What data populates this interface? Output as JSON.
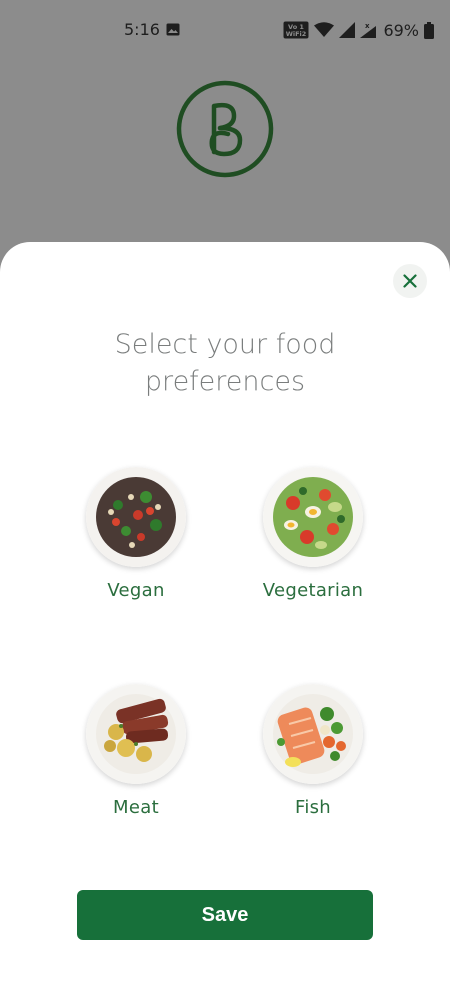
{
  "status_bar": {
    "time": "5:16",
    "image_icon": "image-icon",
    "volte_text": "Vo⁽¹ WiFi²",
    "wifi_icon": "wifi-icon",
    "signal_icon": "signal-icon",
    "signal_x_icon": "signal-no-service-icon",
    "battery_percent": "69%",
    "battery_icon": "battery-icon"
  },
  "background": {
    "logo_icon": "brand-logo-icon",
    "logo_color": "#1f4d22"
  },
  "sheet": {
    "close_icon": "close-icon",
    "title_line1": "Select your food",
    "title_line2": "preferences",
    "options": [
      {
        "label": "Vegan",
        "image": "vegan-dish-image"
      },
      {
        "label": "Vegetarian",
        "image": "vegetarian-salad-image"
      },
      {
        "label": "Meat",
        "image": "meat-dish-image"
      },
      {
        "label": "Fish",
        "image": "fish-dish-image"
      }
    ],
    "save_label": "Save"
  },
  "colors": {
    "accent": "#17703a",
    "label_green": "#2b6e3e",
    "title_gray": "#7a7d7d",
    "backdrop": "#8c8c8c"
  }
}
